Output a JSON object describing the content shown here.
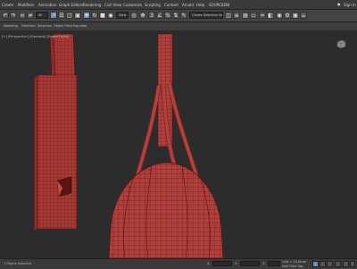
{
  "menus": [
    "Create",
    "Modifiers",
    "Animation",
    "Graph Editors",
    "Rendering",
    "Civil View",
    "Customize",
    "Scripting",
    "Content",
    "Arnold",
    "Help",
    "SOURCEENI"
  ],
  "toolbar": {
    "selection_filter": "All",
    "named_selection": "Create Selection Se",
    "coord_system": "View"
  },
  "sign_in": "Sign In",
  "ribbon_tabs": [
    "Modeling",
    "Freeform",
    "Selection",
    "Object Paint",
    "Populate"
  ],
  "viewport_label": "[+] [Perspective] [Standard] [Edged Faces]",
  "status": {
    "selection": "1 Object Selected",
    "x": "",
    "y": "",
    "z": "",
    "grid": "Grid = 10.0mm",
    "time_tag": "Add Time Tag",
    "auto_key": "Auto Key",
    "selected": "Selected"
  },
  "colors": {
    "mesh_fill": "#a83a36",
    "mesh_wire": "#5a1412",
    "background": "#2c2c2c"
  }
}
